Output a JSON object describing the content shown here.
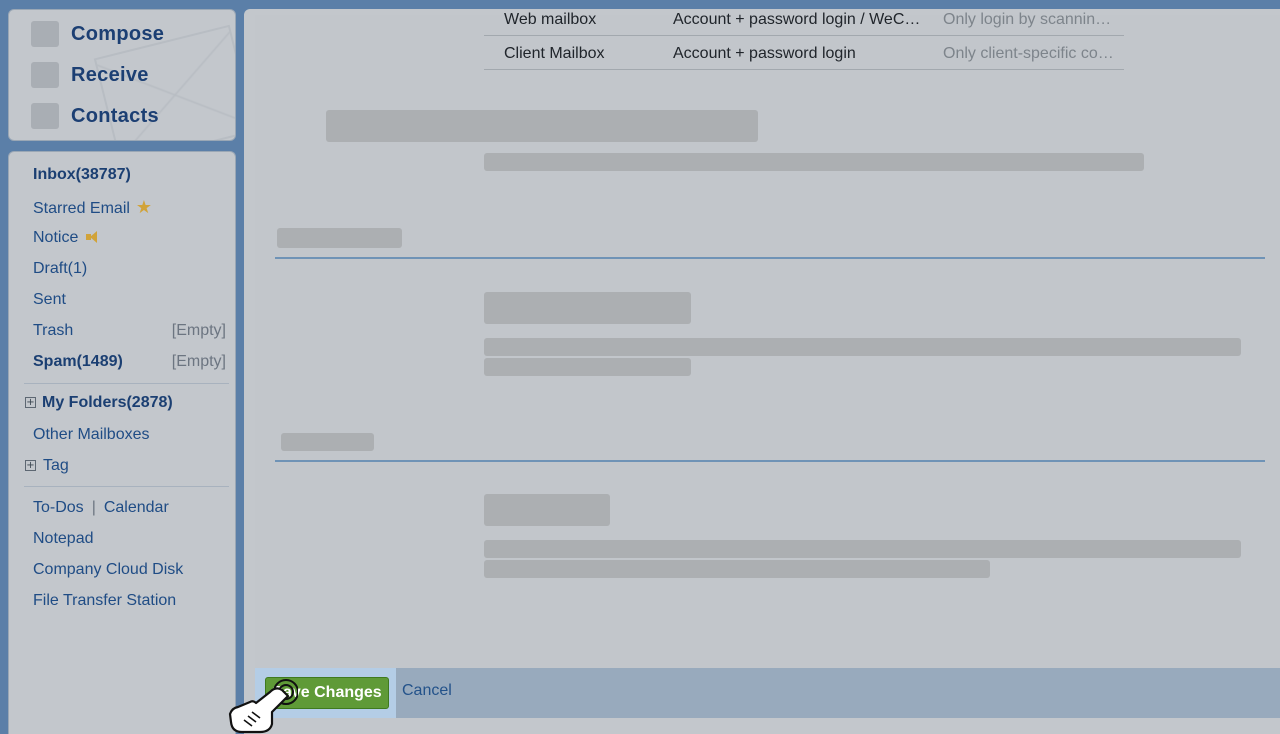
{
  "actions": {
    "compose": "Compose",
    "receive": "Receive",
    "contacts": "Contacts"
  },
  "nav": {
    "inbox": "Inbox(38787)",
    "starred": "Starred Email",
    "notice": "Notice",
    "draft": "Draft(1)",
    "sent": "Sent",
    "trash": "Trash",
    "trash_empty": "[Empty]",
    "spam": "Spam(1489)",
    "spam_empty": "[Empty]",
    "my_folders": "My Folders(2878)",
    "other_mailboxes": "Other Mailboxes",
    "tag": "Tag",
    "todos": "To-Dos",
    "separator": "|",
    "calendar": "Calendar",
    "notepad": "Notepad",
    "cloud_disk": "Company Cloud Disk",
    "file_transfer": "File Transfer Station"
  },
  "table": {
    "rows": [
      {
        "name": "Web mailbox",
        "login": "Account + password login / WeC…",
        "note": "Only login by scannin…"
      },
      {
        "name": "Client Mailbox",
        "login": "Account + password login",
        "note": "Only client-specific co…"
      }
    ]
  },
  "footer": {
    "save": "Save Changes",
    "cancel": "Cancel"
  },
  "colors": {
    "accent_green": "#5f9a37",
    "link_blue": "#1f4c85",
    "divider_blue": "#6f93b6"
  },
  "icons": {
    "starred": "star-icon",
    "notice": "speaker-icon",
    "expand": "plus-box-icon",
    "cursor": "hand-pointer-icon"
  }
}
